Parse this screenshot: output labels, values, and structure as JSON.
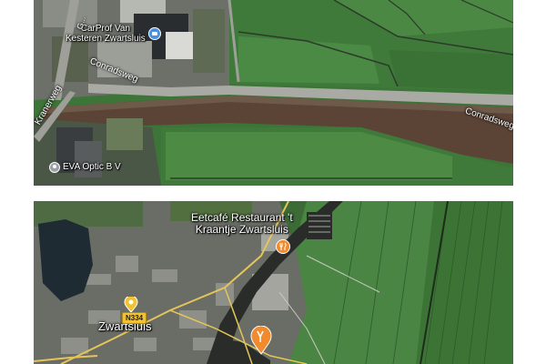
{
  "top_map": {
    "places": {
      "carprof": "CarProf Van\nKesteren Zwartsluis",
      "eva": "EVA Optic B V"
    },
    "roads": {
      "conradsweg_1": "Conradsweg",
      "conradsweg_2": "Conradsweg",
      "kranerweg": "Kranerweg",
      "vertical_street": "G..."
    }
  },
  "bottom_map": {
    "places": {
      "restaurant": "Eetcafé Restaurant 't\nKraantje Zwartsluis",
      "town": "Zwartsluis"
    },
    "road_shield": "N334"
  },
  "colors": {
    "water": "#5b4436",
    "field": "#3f7a3b",
    "field_light": "#4d8a43",
    "restaurant_pin": "#f08a2c",
    "town_pin": "#f2c230",
    "business_pin": "#4a90e2",
    "grey_pin": "#9aa0a6"
  }
}
